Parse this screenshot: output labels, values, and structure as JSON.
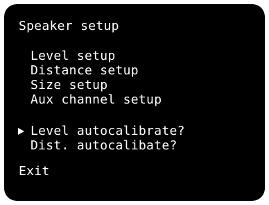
{
  "menu": {
    "title": "Speaker setup",
    "items": [
      {
        "label": "Level setup"
      },
      {
        "label": "Distance setup"
      },
      {
        "label": "Size setup"
      },
      {
        "label": "Aux channel setup"
      },
      {
        "label": "Level autocalibrate?"
      },
      {
        "label": "Dist. autocalibate?"
      }
    ],
    "selected_index": 4,
    "exit_label": "Exit"
  },
  "colors": {
    "background": "#000000",
    "text": "#ffffff"
  },
  "icons": {
    "cursor": "triangle-right-cursor-icon"
  }
}
